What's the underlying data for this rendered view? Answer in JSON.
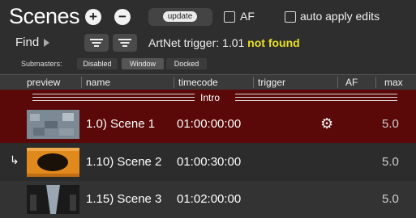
{
  "toolbar": {
    "title": "Scenes",
    "add_label": "+",
    "remove_label": "−",
    "update_label": "update",
    "af_label": "AF",
    "auto_apply_label": "auto apply edits",
    "find_label": "Find",
    "artnet_prefix": "ArtNet trigger: 1.01",
    "artnet_status": "not found"
  },
  "submasters": {
    "label": "Submasters:",
    "options": [
      "Disabled",
      "Window",
      "Docked"
    ],
    "selected": "Window"
  },
  "columns": [
    "preview",
    "name",
    "timecode",
    "trigger",
    "AF",
    "max"
  ],
  "group": {
    "label": "Intro"
  },
  "scenes": [
    {
      "name": "1.0) Scene 1",
      "timecode": "01:00:00:00",
      "max": "5.0",
      "trigger_icon": "gear-icon",
      "linked": false,
      "selected": true
    },
    {
      "name": "1.10) Scene 2",
      "timecode": "01:00:30:00",
      "max": "5.0",
      "linked": true,
      "selected": false
    },
    {
      "name": "1.15) Scene 3",
      "timecode": "01:02:00:00",
      "max": "5.0",
      "linked": false,
      "selected": false
    }
  ],
  "colors": {
    "selected_row": "#5a0808",
    "status_warning": "#e8e020"
  }
}
